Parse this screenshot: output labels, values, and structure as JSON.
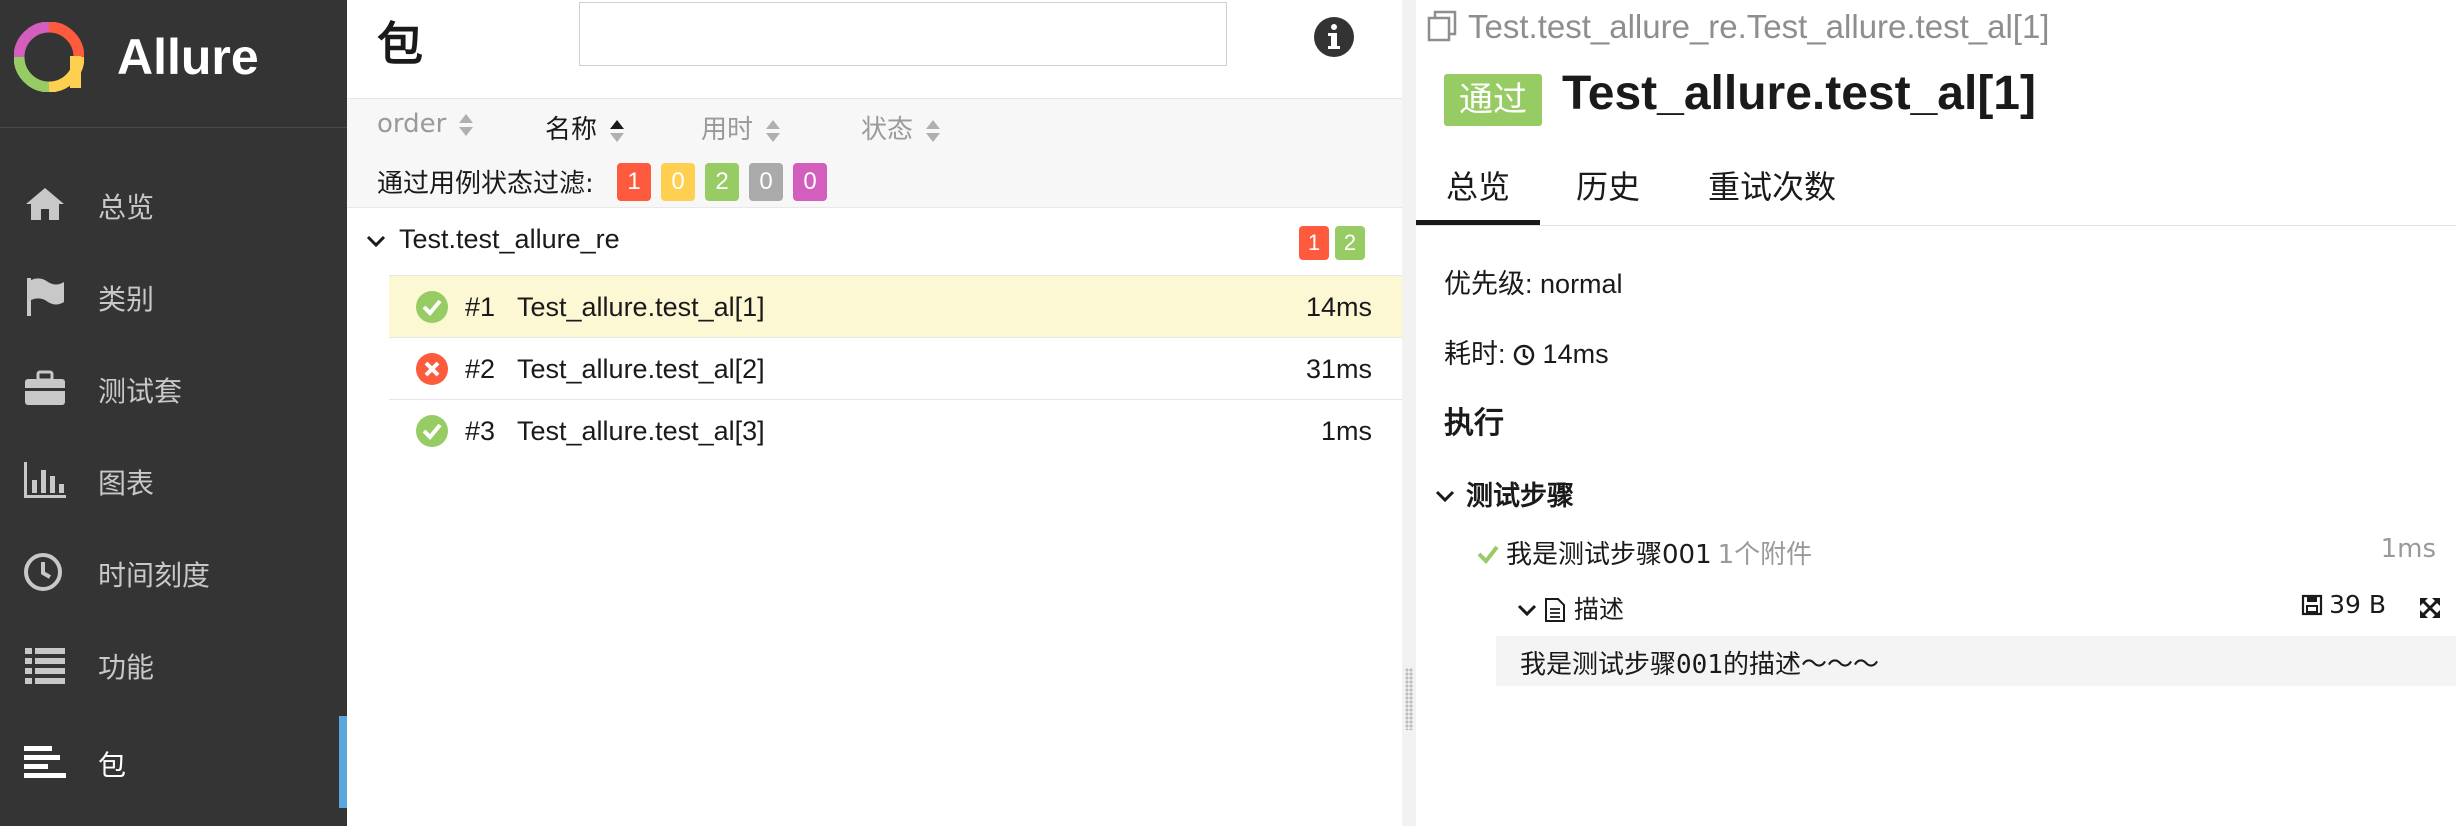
{
  "sidebar": {
    "brand": "Allure",
    "items": [
      {
        "label": "总览",
        "icon": "home-icon"
      },
      {
        "label": "类别",
        "icon": "flag-icon"
      },
      {
        "label": "测试套",
        "icon": "briefcase-icon"
      },
      {
        "label": "图表",
        "icon": "bar-chart-icon"
      },
      {
        "label": "时间刻度",
        "icon": "clock-icon"
      },
      {
        "label": "功能",
        "icon": "list-icon"
      },
      {
        "label": "包",
        "icon": "align-left-icon",
        "active": true
      }
    ],
    "accent": "#5aa7dd"
  },
  "packages": {
    "title": "包",
    "search_value": "",
    "sort": {
      "order": "order",
      "name": "名称",
      "duration": "用时",
      "status": "状态"
    },
    "filter_label": "通过用例状态过滤:",
    "filter_badges": [
      {
        "value": "1",
        "color": "#fd5a3e"
      },
      {
        "value": "0",
        "color": "#ffd050"
      },
      {
        "value": "2",
        "color": "#97cc64"
      },
      {
        "value": "0",
        "color": "#aaaaaa"
      },
      {
        "value": "0",
        "color": "#d35ebe"
      }
    ],
    "group": {
      "name": "Test.test_allure_re",
      "badges": [
        {
          "value": "1",
          "color": "#fd5a3e"
        },
        {
          "value": "2",
          "color": "#97cc64"
        }
      ]
    },
    "rows": [
      {
        "num": "#1",
        "name": "Test_allure.test_al[1]",
        "duration": "14ms",
        "status": "passed"
      },
      {
        "num": "#2",
        "name": "Test_allure.test_al[2]",
        "duration": "31ms",
        "status": "failed"
      },
      {
        "num": "#3",
        "name": "Test_allure.test_al[3]",
        "duration": "1ms",
        "status": "passed"
      }
    ]
  },
  "detail": {
    "breadcrumb": "Test.test_allure_re.Test_allure.test_al[1]",
    "status_label": "通过",
    "title": "Test_allure.test_al[1]",
    "tabs": [
      "总览",
      "历史",
      "重试次数"
    ],
    "severity_label": "优先级:",
    "severity_value": "normal",
    "duration_label": "耗时:",
    "duration_value": "14ms",
    "section_title": "执行",
    "steps_title": "测试步骤",
    "step": {
      "name": "我是测试步骤001",
      "attachments": "1个附件",
      "duration": "1ms"
    },
    "attachment": {
      "name": "描述",
      "size": "39 B",
      "content": "我是测试步骤001的描述～～～"
    }
  }
}
